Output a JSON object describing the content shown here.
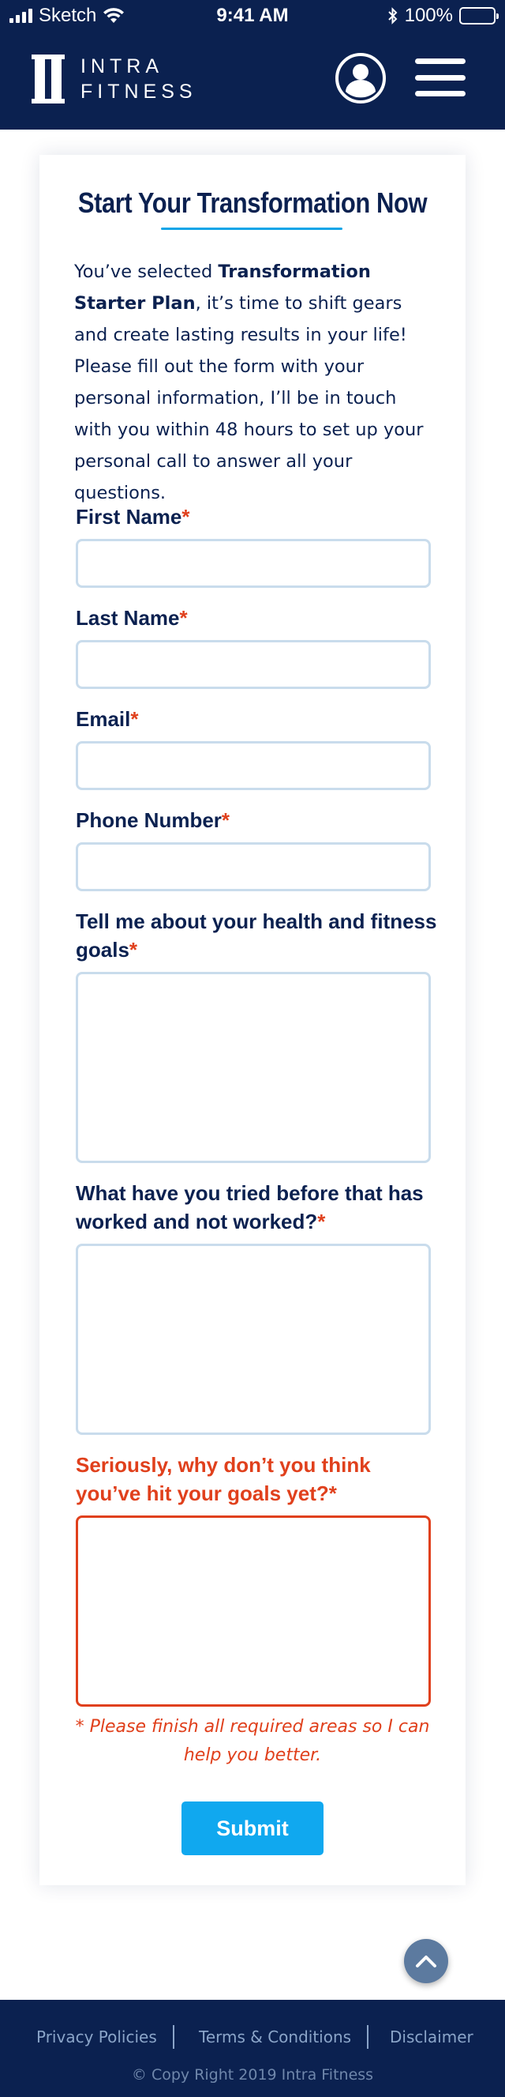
{
  "status_bar": {
    "carrier": "Sketch",
    "time": "9:41 AM",
    "battery": "100%"
  },
  "header": {
    "logo_line1": "INTRA",
    "logo_line2": "FITNESS"
  },
  "form": {
    "title": "Start Your Transformation Now",
    "intro_prefix": "You’ve selected ",
    "intro_plan": "Transformation Starter Plan",
    "intro_suffix": ", it’s time to shift gears and create lasting results in your life! Please fill out the form with your personal information, I’ll be in touch with you within 48 hours to set up your personal call to answer all your questions.",
    "required_mark": "*",
    "fields": [
      {
        "label": "First Name",
        "value": ""
      },
      {
        "label": "Last Name",
        "value": ""
      },
      {
        "label": "Email",
        "value": ""
      },
      {
        "label": "Phone Number",
        "value": ""
      },
      {
        "label": "Tell me about your health and fitness goals",
        "value": ""
      },
      {
        "label": "What have you tried before that has worked and not worked?",
        "value": ""
      },
      {
        "label": "Seriously, why don’t you think you’ve hit your goals yet?",
        "value": ""
      }
    ],
    "error_message": "* Please finish all required areas so I can help you better.",
    "submit_label": "Submit"
  },
  "footer": {
    "links": [
      "Privacy Policies",
      "Terms & Conditions",
      "Disclaimer"
    ],
    "copyright": "© Copy Right 2019 Intra Fitness"
  },
  "colors": {
    "navy": "#0b2150",
    "accent_blue": "#10a8ef",
    "error": "#e0401c",
    "input_border": "#c9dcec"
  }
}
